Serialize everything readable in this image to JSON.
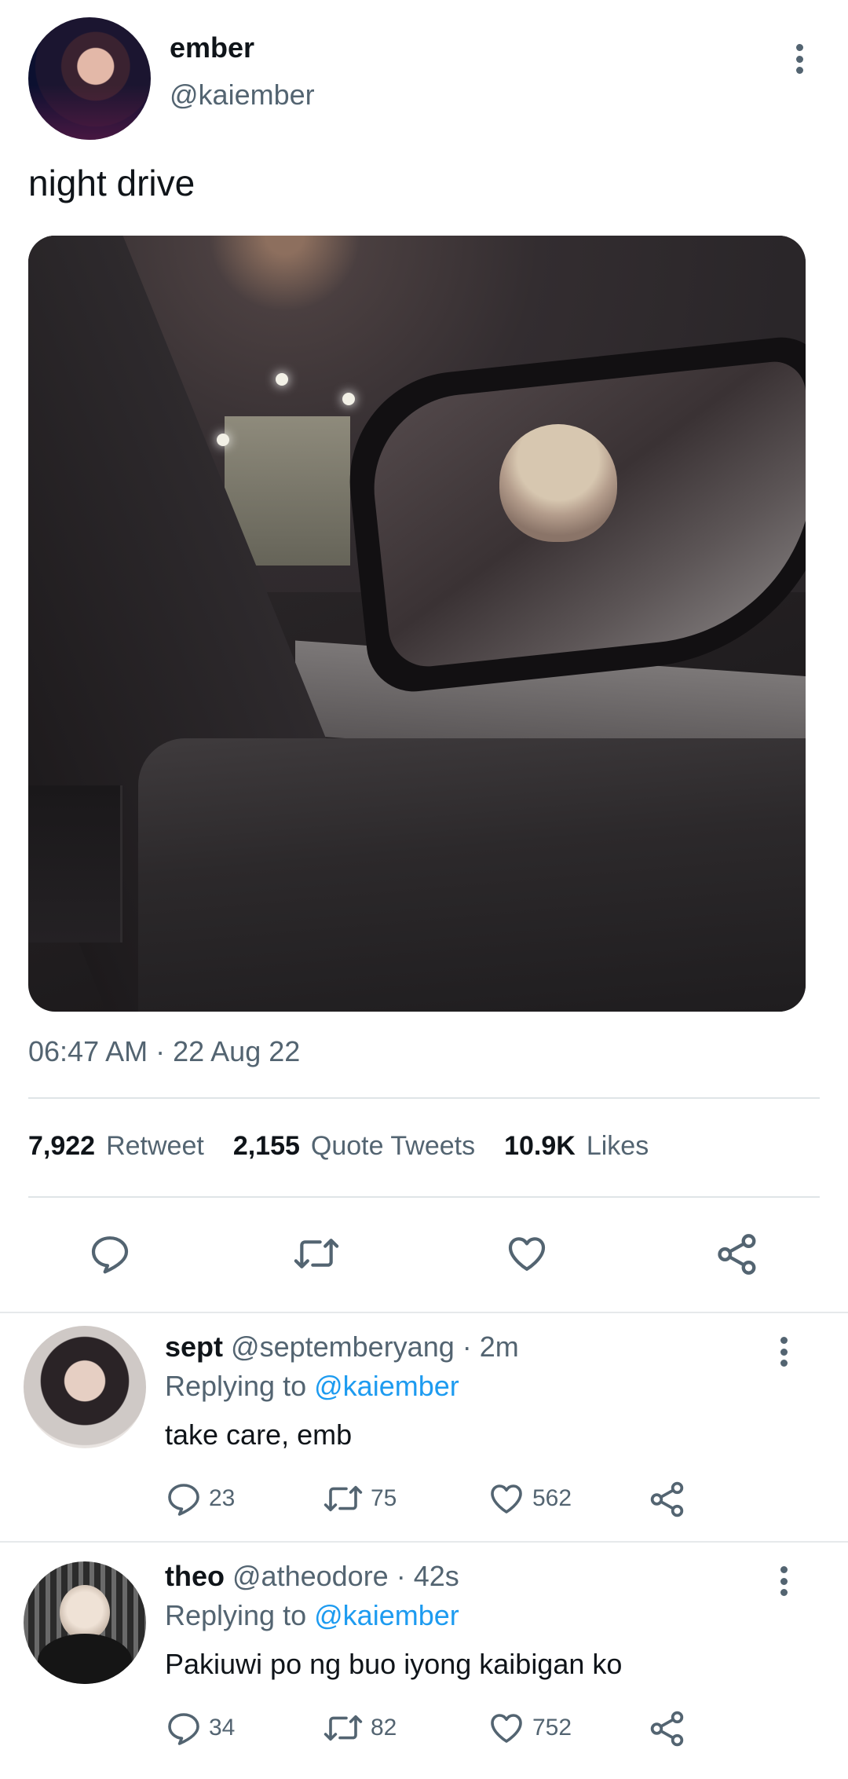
{
  "tweet": {
    "display_name": "ember",
    "handle": "@kaiember",
    "text": "night drive",
    "timestamp": "06:47 AM · 22 Aug 22",
    "stats": [
      {
        "num": "7,922",
        "label": "Retweet"
      },
      {
        "num": "2,155",
        "label": "Quote Tweets"
      },
      {
        "num": "10.9K",
        "label": "Likes"
      }
    ],
    "icons": [
      "reply-icon",
      "retweet-icon",
      "like-icon",
      "share-icon"
    ]
  },
  "replies": [
    {
      "name": "sept",
      "meta": "@septemberyang · 2m",
      "replying_prefix": "Replying to",
      "replying_to": "@kaiember",
      "text": "take care, emb",
      "replies": "23",
      "retweets": "75",
      "likes": "562"
    },
    {
      "name": "theo",
      "meta": "@atheodore · 42s",
      "replying_prefix": "Replying to",
      "replying_to": "@kaiember",
      "text": "Pakiuwi po ng buo iyong kaibigan ko",
      "replies": "34",
      "retweets": "82",
      "likes": "752"
    }
  ],
  "colors": {
    "text": "#0f1419",
    "secondary": "#536471",
    "link": "#1d9bf0",
    "divider": "#dfe4e7"
  }
}
